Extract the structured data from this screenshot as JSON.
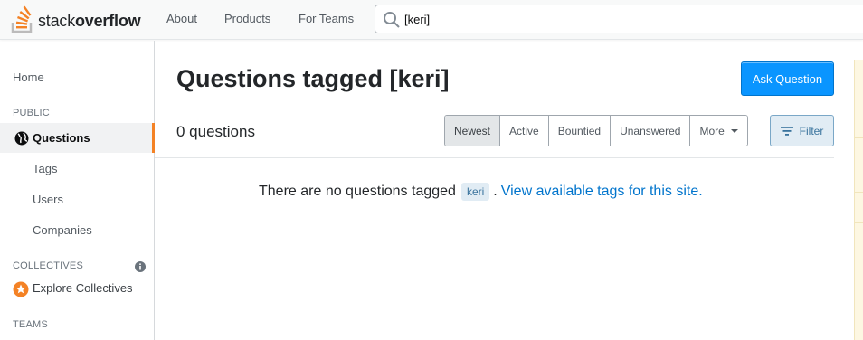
{
  "header": {
    "logo_word_light": "stack",
    "logo_word_bold": "overflow",
    "nav": [
      "About",
      "Products",
      "For Teams"
    ],
    "search_value": "[keri]"
  },
  "sidebar": {
    "home": "Home",
    "public_heading": "PUBLIC",
    "questions": "Questions",
    "tags": "Tags",
    "users": "Users",
    "companies": "Companies",
    "collectives_heading": "COLLECTIVES",
    "explore_collectives": "Explore Collectives",
    "teams_heading": "TEAMS"
  },
  "main": {
    "title": "Questions tagged [keri]",
    "ask_button": "Ask Question",
    "count": "0 questions",
    "filters": [
      "Newest",
      "Active",
      "Bountied",
      "Unanswered",
      "More"
    ],
    "selected_filter": "Newest",
    "filter_button": "Filter",
    "empty_text": "There are no questions tagged",
    "tag": "keri",
    "empty_link": "View available tags for this site."
  },
  "colors": {
    "accent_orange": "#f48225",
    "primary_blue": "#0a95ff",
    "link_blue": "#0074cc",
    "tag_bg": "#e1ecf4"
  }
}
